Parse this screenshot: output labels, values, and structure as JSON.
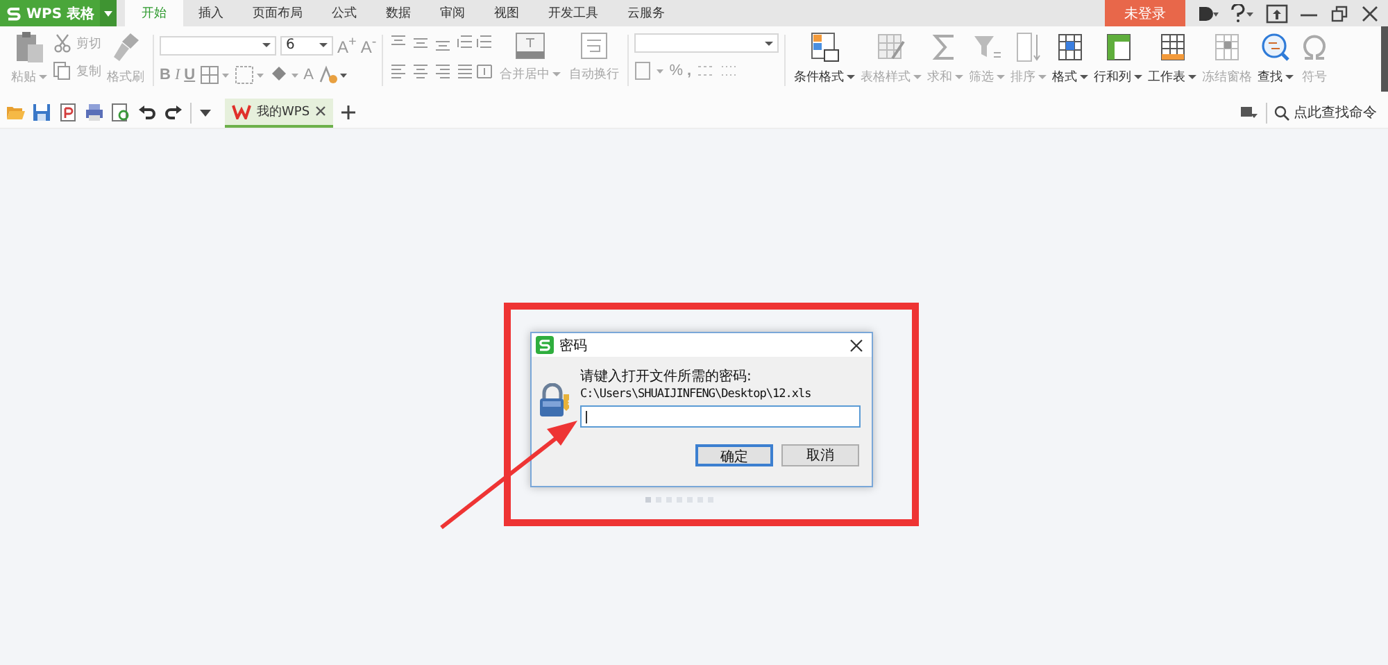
{
  "app_button": {
    "label": "WPS 表格"
  },
  "tabs": [
    {
      "label": "开始",
      "selected": true
    },
    {
      "label": "插入",
      "selected": false
    },
    {
      "label": "页面布局",
      "selected": false
    },
    {
      "label": "公式",
      "selected": false
    },
    {
      "label": "数据",
      "selected": false
    },
    {
      "label": "审阅",
      "selected": false
    },
    {
      "label": "视图",
      "selected": false
    },
    {
      "label": "开发工具",
      "selected": false
    },
    {
      "label": "云服务",
      "selected": false
    }
  ],
  "login_button": {
    "label": "未登录"
  },
  "ribbon": {
    "clipboard": [
      {
        "label": "粘贴",
        "disabled": true,
        "dropdown": true
      },
      {
        "label": "剪切",
        "disabled": true,
        "dropdown": false
      },
      {
        "label": "复制",
        "disabled": true,
        "dropdown": false
      },
      {
        "label": "格式刷",
        "disabled": true,
        "dropdown": false
      }
    ],
    "font": {
      "size": "6",
      "grow": "A$^{+}$",
      "shrink": "A$^{-}$",
      "bold": "B",
      "italic": "I",
      "underline": "U",
      "font_color": "A"
    },
    "alignment": [
      {
        "label": "合并居中",
        "disabled": true,
        "dropdown": true
      },
      {
        "label": "自动换行",
        "disabled": true,
        "dropdown": false
      }
    ],
    "number": {
      "percent": "%",
      "comma": ","
    },
    "tools": [
      {
        "label": "条件格式",
        "disabled": false,
        "dropdown": true
      },
      {
        "label": "表格样式",
        "disabled": true,
        "dropdown": true
      },
      {
        "label": "求和",
        "disabled": true,
        "dropdown": true
      },
      {
        "label": "筛选",
        "disabled": true,
        "dropdown": true
      },
      {
        "label": "排序",
        "disabled": true,
        "dropdown": true
      },
      {
        "label": "格式",
        "disabled": false,
        "dropdown": true
      },
      {
        "label": "行和列",
        "disabled": false,
        "dropdown": true
      },
      {
        "label": "工作表",
        "disabled": false,
        "dropdown": true
      },
      {
        "label": "冻结窗格",
        "disabled": true,
        "dropdown": false
      },
      {
        "label": "查找",
        "disabled": false,
        "dropdown": true
      },
      {
        "label": "符号",
        "disabled": true,
        "dropdown": false
      }
    ]
  },
  "doc_tabs": [
    {
      "label": "我的WPS",
      "selected": true
    }
  ],
  "command_search": {
    "placeholder": "点此查找命令"
  },
  "dialog": {
    "title": "密码",
    "prompt": "请键入打开文件所需的密码:",
    "path": "C:\\Users\\SHUAIJINFENG\\Desktop\\12.xls",
    "buttons": [
      {
        "label": "确定",
        "default": true
      },
      {
        "label": "取消",
        "default": false
      }
    ]
  }
}
